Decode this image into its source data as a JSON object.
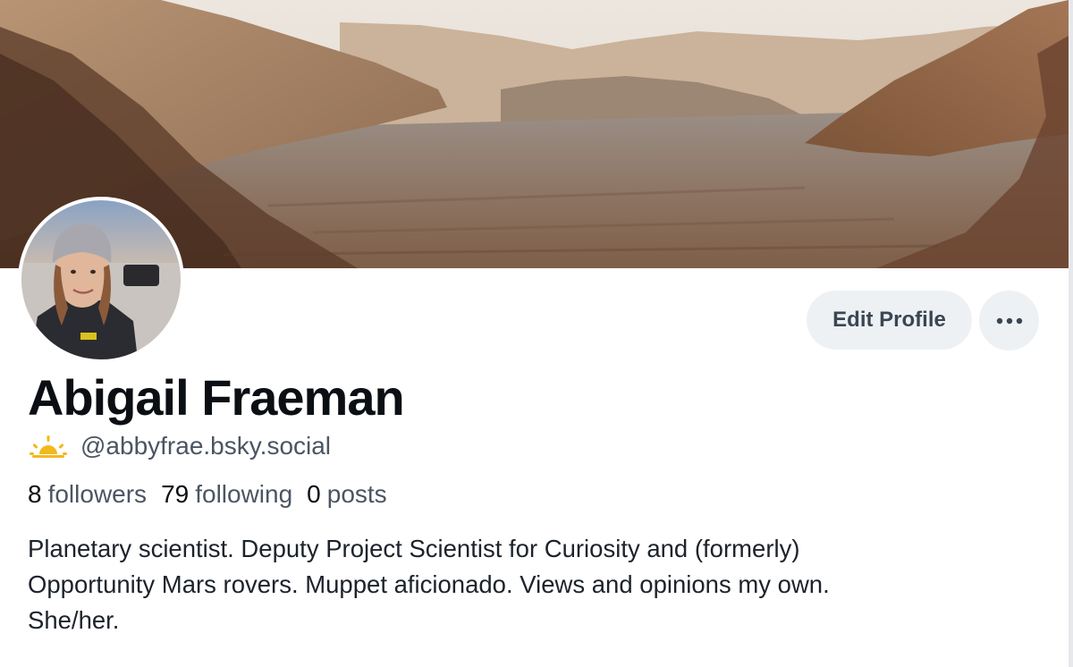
{
  "profile": {
    "name": "Abigail Fraeman",
    "handle": "@abbyfrae.bsky.social",
    "handle_icon": "sunrise-icon",
    "bio": "Planetary scientist. Deputy Project Scientist for Curiosity and (formerly)\nOpportunity Mars rovers. Muppet aficionado. Views and opinions my own.\nShe/her."
  },
  "stats": {
    "followers_count": "8",
    "followers_label": "followers",
    "following_count": "79",
    "following_label": "following",
    "posts_count": "0",
    "posts_label": "posts"
  },
  "actions": {
    "edit_label": "Edit Profile",
    "more_icon": "more-horizontal-icon"
  },
  "banner": {
    "subject": "martian-landscape"
  },
  "colors": {
    "button_bg": "#eef1f4",
    "button_text": "#3b4653",
    "secondary_text": "#4b5563",
    "sun_icon": "#f2b81d"
  }
}
